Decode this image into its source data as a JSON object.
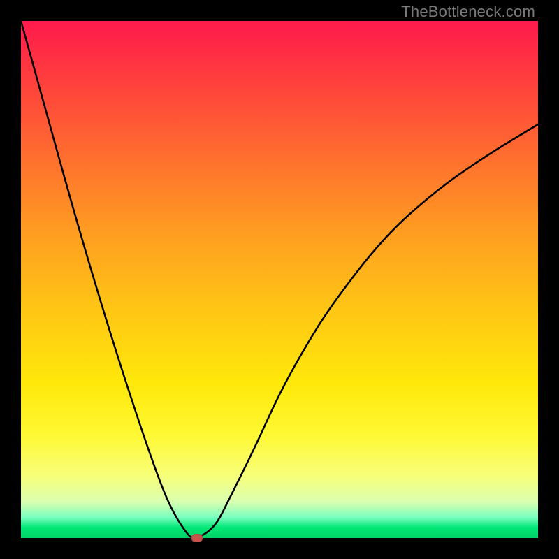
{
  "watermark": "TheBottleneck.com",
  "colors": {
    "frame": "#000000",
    "curve": "#000000",
    "marker": "#c9544a",
    "gradient_top": "#ff1a4b",
    "gradient_bottom": "#00d463"
  },
  "chart_data": {
    "type": "line",
    "title": "",
    "xlabel": "",
    "ylabel": "",
    "xlim": [
      0,
      100
    ],
    "ylim": [
      0,
      100
    ],
    "series": [
      {
        "name": "bottleneck-curve",
        "x": [
          0,
          5,
          10,
          15,
          20,
          25,
          28,
          30,
          32,
          33,
          34,
          36,
          38,
          40,
          45,
          50,
          55,
          60,
          70,
          80,
          90,
          100
        ],
        "y": [
          100,
          82,
          64,
          47,
          31,
          16,
          8,
          4,
          1,
          0,
          0,
          1,
          3,
          7,
          17,
          28,
          37,
          45,
          58,
          67,
          74,
          80
        ]
      }
    ],
    "annotations": [
      {
        "name": "minimum-marker",
        "x": 34,
        "y": 0
      }
    ]
  }
}
